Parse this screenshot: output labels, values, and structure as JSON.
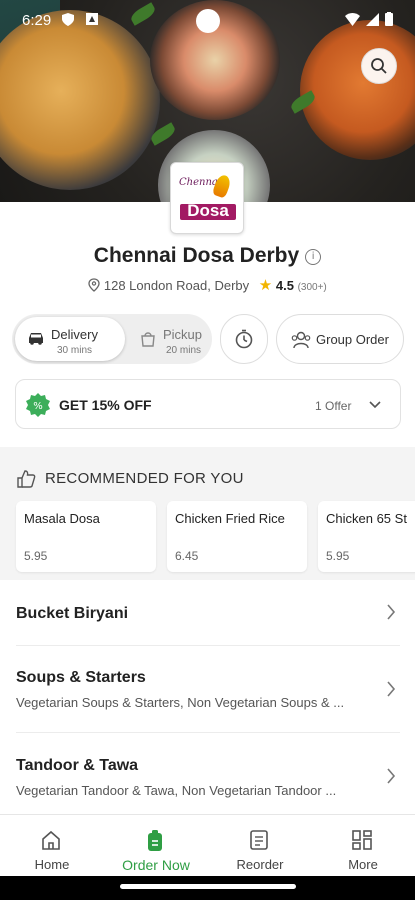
{
  "status_bar": {
    "time": "6:29"
  },
  "restaurant": {
    "name": "Chennai Dosa Derby",
    "address": "128 London Road, Derby",
    "rating": "4.5",
    "rating_count": "(300+)",
    "logo_top": "Chennai",
    "logo_main": "Dosa"
  },
  "order_mode": {
    "delivery_label": "Delivery",
    "delivery_time": "30 mins",
    "pickup_label": "Pickup",
    "pickup_time": "20 mins"
  },
  "group_order_label": "Group Order",
  "offer": {
    "text": "GET 15% OFF",
    "count": "1 Offer"
  },
  "recommended": {
    "title": "RECOMMENDED FOR YOU",
    "items": [
      {
        "name": "Masala Dosa",
        "price": "5.95"
      },
      {
        "name": "Chicken Fried Rice",
        "price": "6.45"
      },
      {
        "name": "Chicken 65 St",
        "price": "5.95"
      }
    ]
  },
  "categories": [
    {
      "title": "Bucket Biryani",
      "desc": ""
    },
    {
      "title": "Soups & Starters",
      "desc": "Vegetarian Soups & Starters, Non Vegetarian Soups & ..."
    },
    {
      "title": "Tandoor & Tawa",
      "desc": "Vegetarian Tandoor & Tawa, Non Vegetarian Tandoor ..."
    }
  ],
  "nav": {
    "home": "Home",
    "order_now": "Order Now",
    "reorder": "Reorder",
    "more": "More"
  },
  "colors": {
    "accent_green": "#2f9e44",
    "rating_star": "#f2b400",
    "logo_brand": "#a21a63"
  }
}
